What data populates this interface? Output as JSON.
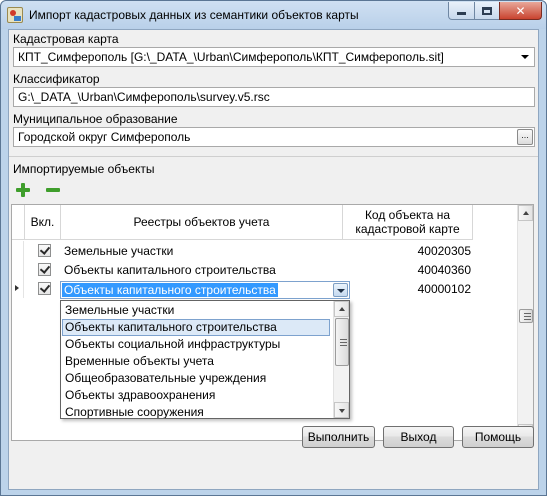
{
  "window": {
    "title": "Импорт кадастровых данных из семантики объектов карты",
    "close_glyph": "✕"
  },
  "form": {
    "cadastral_map": {
      "label": "Кадастровая карта",
      "value": "КПТ_Симферополь [G:\\_DATA_\\Urban\\Симферополь\\КПТ_Симферополь.sit]"
    },
    "classifier": {
      "label": "Классификатор",
      "value": "G:\\_DATA_\\Urban\\Симферополь\\survey.v5.rsc"
    },
    "municipality": {
      "label": "Муниципальное образование",
      "value": "Городской округ Симферополь",
      "browse_glyph": "..."
    },
    "imported_objects_label": "Импортируемые объекты"
  },
  "table": {
    "columns": [
      "Вкл.",
      "Реестры объектов учета",
      "Код объекта на кадастровой карте"
    ],
    "rows": [
      {
        "enabled": true,
        "registry": "Земельные участки",
        "code": "40020305"
      },
      {
        "enabled": true,
        "registry": "Объекты капитального строительства",
        "code": "40040360"
      },
      {
        "enabled": true,
        "registry": "Объекты капитального строительства",
        "code": "40000102"
      }
    ]
  },
  "dropdown": {
    "selected": "Объекты капитального строительства",
    "options": [
      "Земельные участки",
      "Объекты капитального строительства",
      "Объекты социальной инфраструктуры",
      "Временные объекты учета",
      "Общеобразовательные учреждения",
      "Объекты здравоохранения",
      "Спортивные сооружения"
    ]
  },
  "buttons": {
    "execute": "Выполнить",
    "exit": "Выход",
    "help": "Помощь"
  }
}
